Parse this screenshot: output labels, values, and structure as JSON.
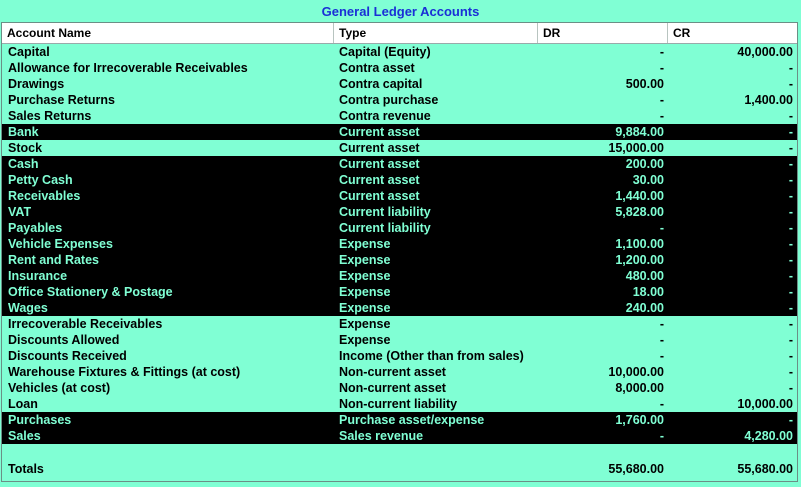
{
  "window": {
    "title": "General Ledger Accounts"
  },
  "table": {
    "columns": [
      "Account Name",
      "Type",
      "DR",
      "CR"
    ],
    "rows": [
      {
        "name": "Capital",
        "type": "Capital (Equity)",
        "dr": "-",
        "cr": "40,000.00",
        "highlight": false
      },
      {
        "name": "Allowance for Irrecoverable Receivables",
        "type": "Contra asset",
        "dr": "-",
        "cr": "-",
        "highlight": false
      },
      {
        "name": "Drawings",
        "type": "Contra capital",
        "dr": "500.00",
        "cr": "-",
        "highlight": false
      },
      {
        "name": "Purchase Returns",
        "type": "Contra purchase",
        "dr": "-",
        "cr": "1,400.00",
        "highlight": false
      },
      {
        "name": "Sales Returns",
        "type": "Contra revenue",
        "dr": "-",
        "cr": "-",
        "highlight": false
      },
      {
        "name": "Bank",
        "type": "Current asset",
        "dr": "9,884.00",
        "cr": "-",
        "highlight": true
      },
      {
        "name": "Stock",
        "type": "Current asset",
        "dr": "15,000.00",
        "cr": "-",
        "highlight": false
      },
      {
        "name": "Cash",
        "type": "Current asset",
        "dr": "200.00",
        "cr": "-",
        "highlight": true
      },
      {
        "name": "Petty Cash",
        "type": "Current asset",
        "dr": "30.00",
        "cr": "-",
        "highlight": true
      },
      {
        "name": "Receivables",
        "type": "Current asset",
        "dr": "1,440.00",
        "cr": "-",
        "highlight": true
      },
      {
        "name": "VAT",
        "type": "Current liability",
        "dr": "5,828.00",
        "cr": "-",
        "highlight": true
      },
      {
        "name": "Payables",
        "type": "Current liability",
        "dr": "-",
        "cr": "-",
        "highlight": true
      },
      {
        "name": "Vehicle Expenses",
        "type": "Expense",
        "dr": "1,100.00",
        "cr": "-",
        "highlight": true
      },
      {
        "name": "Rent and Rates",
        "type": "Expense",
        "dr": "1,200.00",
        "cr": "-",
        "highlight": true
      },
      {
        "name": "Insurance",
        "type": "Expense",
        "dr": "480.00",
        "cr": "-",
        "highlight": true
      },
      {
        "name": "Office Stationery & Postage",
        "type": "Expense",
        "dr": "18.00",
        "cr": "-",
        "highlight": true
      },
      {
        "name": "Wages",
        "type": "Expense",
        "dr": "240.00",
        "cr": "-",
        "highlight": true
      },
      {
        "name": "Irrecoverable Receivables",
        "type": "Expense",
        "dr": "-",
        "cr": "-",
        "highlight": false
      },
      {
        "name": "Discounts Allowed",
        "type": "Expense",
        "dr": "-",
        "cr": "-",
        "highlight": false
      },
      {
        "name": "Discounts Received",
        "type": "Income (Other than from sales)",
        "dr": "-",
        "cr": "-",
        "highlight": false
      },
      {
        "name": "Warehouse Fixtures & Fittings (at cost)",
        "type": "Non-current asset",
        "dr": "10,000.00",
        "cr": "-",
        "highlight": false
      },
      {
        "name": "Vehicles (at cost)",
        "type": "Non-current asset",
        "dr": "8,000.00",
        "cr": "-",
        "highlight": false
      },
      {
        "name": "Loan",
        "type": "Non-current liability",
        "dr": "-",
        "cr": "10,000.00",
        "highlight": false
      },
      {
        "name": "Purchases",
        "type": "Purchase asset/expense",
        "dr": "1,760.00",
        "cr": "-",
        "highlight": true
      },
      {
        "name": "Sales",
        "type": "Sales revenue",
        "dr": "-",
        "cr": "4,280.00",
        "highlight": true
      }
    ],
    "totals": {
      "label": "Totals",
      "dr": "55,680.00",
      "cr": "55,680.00"
    }
  },
  "colors": {
    "background": "#80ffd4",
    "highlight_background": "#000000",
    "highlight_text": "#80ffd4",
    "title_text": "#1a2fd6"
  }
}
